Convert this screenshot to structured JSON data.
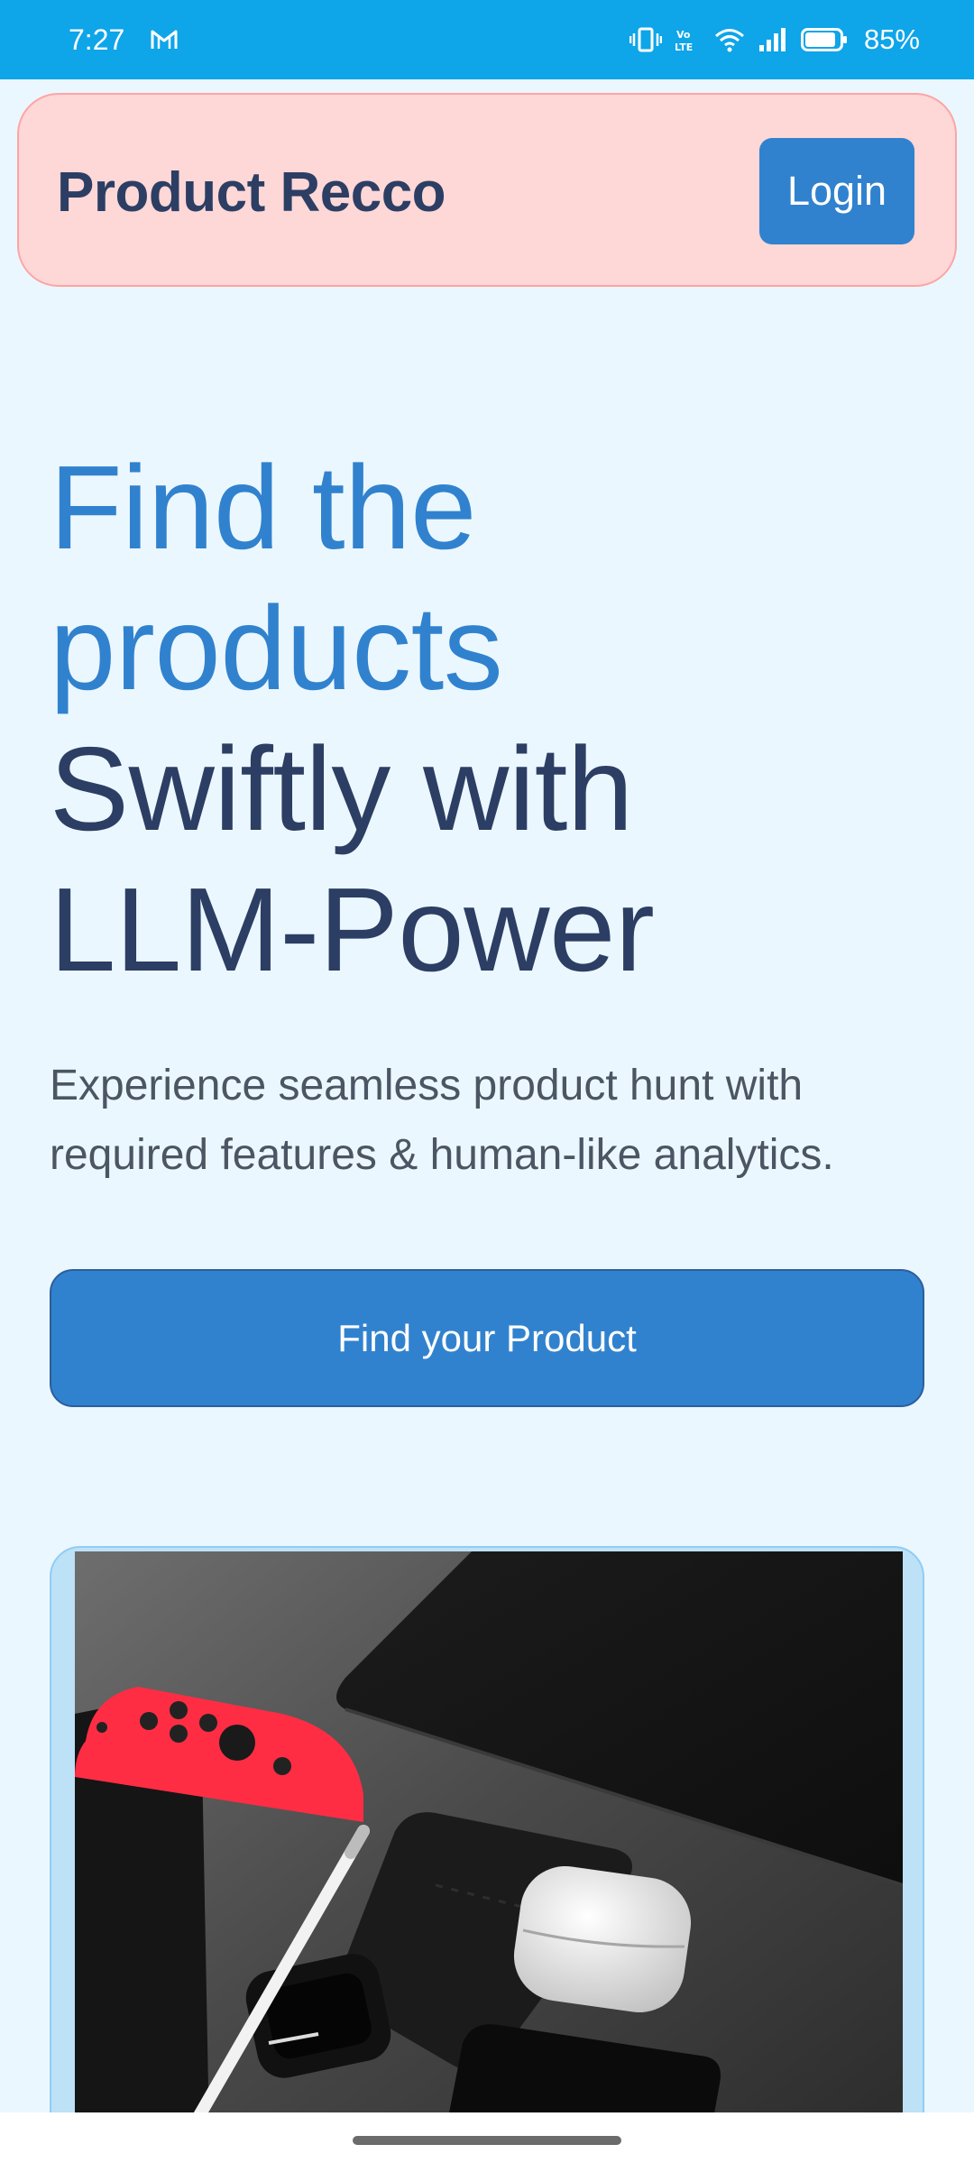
{
  "status_bar": {
    "time": "7:27",
    "notification_icon": "gmail-icon",
    "battery_percent": "85%",
    "icons": [
      "vibrate-icon",
      "volte-icon",
      "wifi-icon",
      "signal-icon",
      "battery-icon"
    ]
  },
  "header": {
    "brand": "Product Recco",
    "login_label": "Login"
  },
  "hero": {
    "title_line1": "Find the",
    "title_line2": "products",
    "title_line3": "Swiftly with",
    "title_line4": "LLM-Power",
    "subtitle_line1": "Experience seamless product hunt with",
    "subtitle_line2": "required features & human-like analytics.",
    "cta_label": "Find your Product"
  },
  "colors": {
    "status_bar": "#0ea5e9",
    "page_background": "#ebf7fe",
    "header_background": "#fed7d7",
    "accent": "#3182ce",
    "dark_text": "#2c3e63"
  }
}
